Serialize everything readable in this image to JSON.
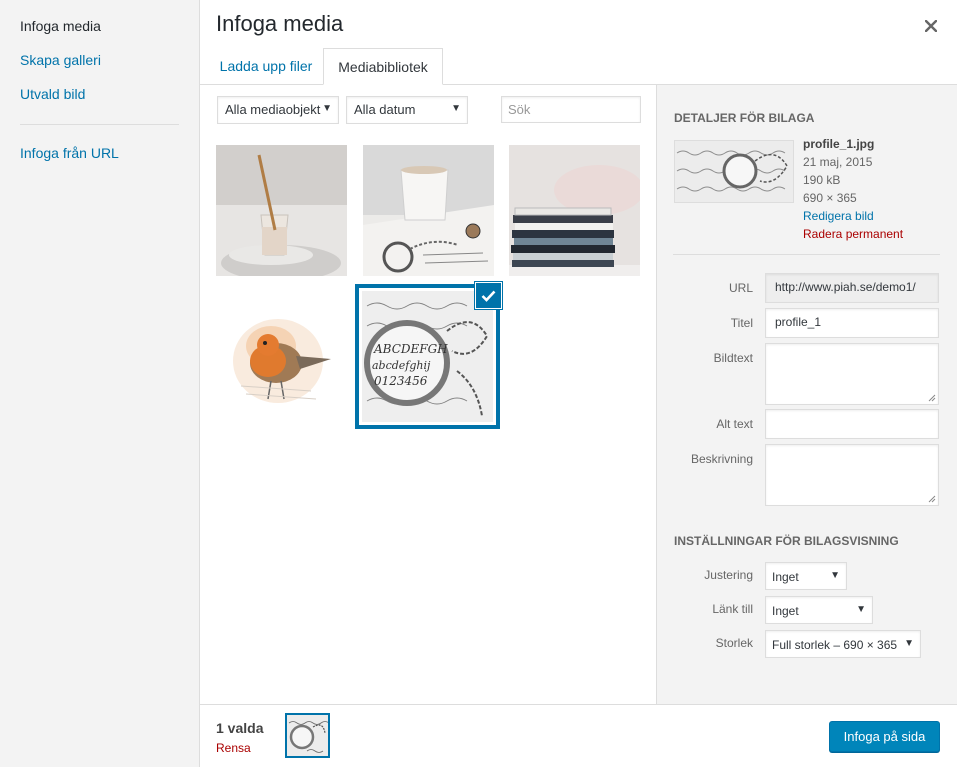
{
  "menu": {
    "items": [
      {
        "label": "Infoga media"
      },
      {
        "label": "Skapa galleri"
      },
      {
        "label": "Utvald bild"
      },
      {
        "label": "Infoga från URL"
      }
    ]
  },
  "header": {
    "title": "Infoga media",
    "close_icon": "close-icon"
  },
  "tabs": [
    {
      "label": "Ladda upp filer"
    },
    {
      "label": "Mediabibliotek",
      "active": true
    }
  ],
  "filters": {
    "type_select": "Alla mediaobjekt",
    "date_select": "Alla datum",
    "search_placeholder": "Sök"
  },
  "attachments": [
    {
      "name": "milk-glass-spoon"
    },
    {
      "name": "coffee-cup-magnifier"
    },
    {
      "name": "book-stack"
    },
    {
      "name": "robin-bird"
    },
    {
      "name": "magnifier-lettering",
      "selected": true
    }
  ],
  "details": {
    "heading": "Detaljer för bilaga",
    "filename": "profile_1.jpg",
    "date": "21 maj, 2015",
    "size": "190 kB",
    "dimensions": "690 × 365",
    "edit_link": "Redigera bild",
    "delete_link": "Radera permanent"
  },
  "fields": {
    "url_label": "URL",
    "url_value": "http://www.piah.se/demo1/",
    "title_label": "Titel",
    "title_value": "profile_1",
    "caption_label": "Bildtext",
    "alt_label": "Alt text",
    "description_label": "Beskrivning"
  },
  "display_settings": {
    "heading": "Inställningar för bilagsvisning",
    "align_label": "Justering",
    "align_value": "Inget",
    "link_label": "Länk till",
    "link_value": "Inget",
    "size_label": "Storlek",
    "size_value": "Full storlek – 690 × 365"
  },
  "footer": {
    "selected_count": "1 valda",
    "clear_link": "Rensa",
    "insert_button": "Infoga på sida"
  },
  "colors": {
    "accent": "#0073aa",
    "primary_button": "#0085ba",
    "danger": "#a00"
  }
}
